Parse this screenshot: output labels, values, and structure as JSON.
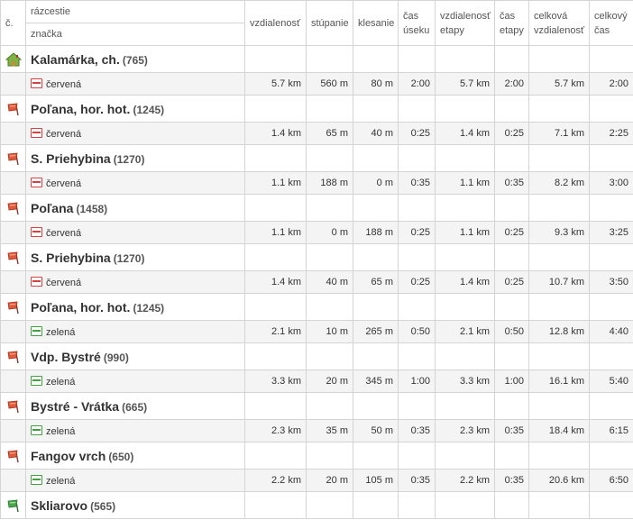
{
  "header": {
    "num": "č.",
    "crossroad": "rázcestie",
    "mark": "značka",
    "distance": "vzdialenosť",
    "ascent": "stúpanie",
    "descent": "klesanie",
    "seg_time": "čas úseku",
    "stage_distance": "vzdialenosť etapy",
    "stage_time": "čas etapy",
    "total_distance": "celková vzdialenosť",
    "total_time": "celkový čas"
  },
  "colors": {
    "red_mark": "#d64040",
    "green_mark": "#3fa23f",
    "flag_red": "#e05a3a",
    "flag_green": "#4aa64a",
    "house": "#7cb342"
  },
  "waypoints": [
    {
      "name": "Kalamárka, ch.",
      "alt": "(765)",
      "icon": "house-icon"
    },
    {
      "name": "Poľana, hor. hot.",
      "alt": "(1245)",
      "icon": "flag-red-icon"
    },
    {
      "name": "S. Priehybina",
      "alt": "(1270)",
      "icon": "flag-red-icon"
    },
    {
      "name": "Poľana",
      "alt": "(1458)",
      "icon": "flag-red-icon"
    },
    {
      "name": "S. Priehybina",
      "alt": "(1270)",
      "icon": "flag-red-icon"
    },
    {
      "name": "Poľana, hor. hot.",
      "alt": "(1245)",
      "icon": "flag-red-icon"
    },
    {
      "name": "Vdp. Bystré",
      "alt": "(990)",
      "icon": "flag-red-icon"
    },
    {
      "name": "Bystré - Vrátka",
      "alt": "(665)",
      "icon": "flag-red-icon"
    },
    {
      "name": "Fangov vrch",
      "alt": "(650)",
      "icon": "flag-red-icon"
    },
    {
      "name": "Skliarovo",
      "alt": "(565)",
      "icon": "flag-green-icon"
    }
  ],
  "segments": [
    {
      "mark": "červená",
      "color": "red",
      "distance": "5.7 km",
      "ascent": "560 m",
      "descent": "80 m",
      "seg_time": "2:00",
      "stage_distance": "5.7 km",
      "stage_time": "2:00",
      "total_distance": "5.7 km",
      "total_time": "2:00"
    },
    {
      "mark": "červená",
      "color": "red",
      "distance": "1.4 km",
      "ascent": "65 m",
      "descent": "40 m",
      "seg_time": "0:25",
      "stage_distance": "1.4 km",
      "stage_time": "0:25",
      "total_distance": "7.1 km",
      "total_time": "2:25"
    },
    {
      "mark": "červená",
      "color": "red",
      "distance": "1.1 km",
      "ascent": "188 m",
      "descent": "0 m",
      "seg_time": "0:35",
      "stage_distance": "1.1 km",
      "stage_time": "0:35",
      "total_distance": "8.2 km",
      "total_time": "3:00"
    },
    {
      "mark": "červená",
      "color": "red",
      "distance": "1.1 km",
      "ascent": "0 m",
      "descent": "188 m",
      "seg_time": "0:25",
      "stage_distance": "1.1 km",
      "stage_time": "0:25",
      "total_distance": "9.3 km",
      "total_time": "3:25"
    },
    {
      "mark": "červená",
      "color": "red",
      "distance": "1.4 km",
      "ascent": "40 m",
      "descent": "65 m",
      "seg_time": "0:25",
      "stage_distance": "1.4 km",
      "stage_time": "0:25",
      "total_distance": "10.7 km",
      "total_time": "3:50"
    },
    {
      "mark": "zelená",
      "color": "green",
      "distance": "2.1 km",
      "ascent": "10 m",
      "descent": "265 m",
      "seg_time": "0:50",
      "stage_distance": "2.1 km",
      "stage_time": "0:50",
      "total_distance": "12.8 km",
      "total_time": "4:40"
    },
    {
      "mark": "zelená",
      "color": "green",
      "distance": "3.3 km",
      "ascent": "20 m",
      "descent": "345 m",
      "seg_time": "1:00",
      "stage_distance": "3.3 km",
      "stage_time": "1:00",
      "total_distance": "16.1 km",
      "total_time": "5:40"
    },
    {
      "mark": "zelená",
      "color": "green",
      "distance": "2.3 km",
      "ascent": "35 m",
      "descent": "50 m",
      "seg_time": "0:35",
      "stage_distance": "2.3 km",
      "stage_time": "0:35",
      "total_distance": "18.4 km",
      "total_time": "6:15"
    },
    {
      "mark": "zelená",
      "color": "green",
      "distance": "2.2 km",
      "ascent": "20 m",
      "descent": "105 m",
      "seg_time": "0:35",
      "stage_distance": "2.2 km",
      "stage_time": "0:35",
      "total_distance": "20.6 km",
      "total_time": "6:50"
    }
  ]
}
